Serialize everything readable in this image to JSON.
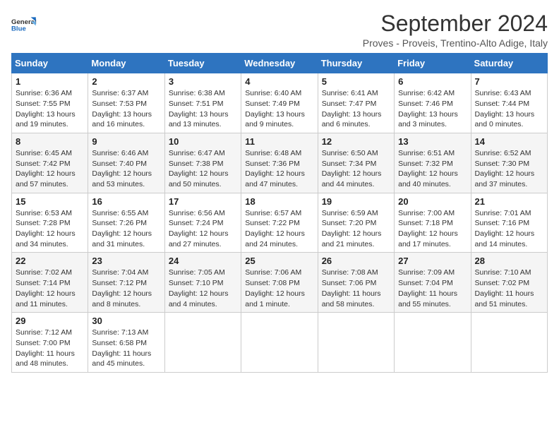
{
  "header": {
    "logo_general": "General",
    "logo_blue": "Blue",
    "month_title": "September 2024",
    "subtitle": "Proves - Proveis, Trentino-Alto Adige, Italy"
  },
  "days_of_week": [
    "Sunday",
    "Monday",
    "Tuesday",
    "Wednesday",
    "Thursday",
    "Friday",
    "Saturday"
  ],
  "weeks": [
    [
      {
        "day": "1",
        "info": "Sunrise: 6:36 AM\nSunset: 7:55 PM\nDaylight: 13 hours\nand 19 minutes."
      },
      {
        "day": "2",
        "info": "Sunrise: 6:37 AM\nSunset: 7:53 PM\nDaylight: 13 hours\nand 16 minutes."
      },
      {
        "day": "3",
        "info": "Sunrise: 6:38 AM\nSunset: 7:51 PM\nDaylight: 13 hours\nand 13 minutes."
      },
      {
        "day": "4",
        "info": "Sunrise: 6:40 AM\nSunset: 7:49 PM\nDaylight: 13 hours\nand 9 minutes."
      },
      {
        "day": "5",
        "info": "Sunrise: 6:41 AM\nSunset: 7:47 PM\nDaylight: 13 hours\nand 6 minutes."
      },
      {
        "day": "6",
        "info": "Sunrise: 6:42 AM\nSunset: 7:46 PM\nDaylight: 13 hours\nand 3 minutes."
      },
      {
        "day": "7",
        "info": "Sunrise: 6:43 AM\nSunset: 7:44 PM\nDaylight: 13 hours\nand 0 minutes."
      }
    ],
    [
      {
        "day": "8",
        "info": "Sunrise: 6:45 AM\nSunset: 7:42 PM\nDaylight: 12 hours\nand 57 minutes."
      },
      {
        "day": "9",
        "info": "Sunrise: 6:46 AM\nSunset: 7:40 PM\nDaylight: 12 hours\nand 53 minutes."
      },
      {
        "day": "10",
        "info": "Sunrise: 6:47 AM\nSunset: 7:38 PM\nDaylight: 12 hours\nand 50 minutes."
      },
      {
        "day": "11",
        "info": "Sunrise: 6:48 AM\nSunset: 7:36 PM\nDaylight: 12 hours\nand 47 minutes."
      },
      {
        "day": "12",
        "info": "Sunrise: 6:50 AM\nSunset: 7:34 PM\nDaylight: 12 hours\nand 44 minutes."
      },
      {
        "day": "13",
        "info": "Sunrise: 6:51 AM\nSunset: 7:32 PM\nDaylight: 12 hours\nand 40 minutes."
      },
      {
        "day": "14",
        "info": "Sunrise: 6:52 AM\nSunset: 7:30 PM\nDaylight: 12 hours\nand 37 minutes."
      }
    ],
    [
      {
        "day": "15",
        "info": "Sunrise: 6:53 AM\nSunset: 7:28 PM\nDaylight: 12 hours\nand 34 minutes."
      },
      {
        "day": "16",
        "info": "Sunrise: 6:55 AM\nSunset: 7:26 PM\nDaylight: 12 hours\nand 31 minutes."
      },
      {
        "day": "17",
        "info": "Sunrise: 6:56 AM\nSunset: 7:24 PM\nDaylight: 12 hours\nand 27 minutes."
      },
      {
        "day": "18",
        "info": "Sunrise: 6:57 AM\nSunset: 7:22 PM\nDaylight: 12 hours\nand 24 minutes."
      },
      {
        "day": "19",
        "info": "Sunrise: 6:59 AM\nSunset: 7:20 PM\nDaylight: 12 hours\nand 21 minutes."
      },
      {
        "day": "20",
        "info": "Sunrise: 7:00 AM\nSunset: 7:18 PM\nDaylight: 12 hours\nand 17 minutes."
      },
      {
        "day": "21",
        "info": "Sunrise: 7:01 AM\nSunset: 7:16 PM\nDaylight: 12 hours\nand 14 minutes."
      }
    ],
    [
      {
        "day": "22",
        "info": "Sunrise: 7:02 AM\nSunset: 7:14 PM\nDaylight: 12 hours\nand 11 minutes."
      },
      {
        "day": "23",
        "info": "Sunrise: 7:04 AM\nSunset: 7:12 PM\nDaylight: 12 hours\nand 8 minutes."
      },
      {
        "day": "24",
        "info": "Sunrise: 7:05 AM\nSunset: 7:10 PM\nDaylight: 12 hours\nand 4 minutes."
      },
      {
        "day": "25",
        "info": "Sunrise: 7:06 AM\nSunset: 7:08 PM\nDaylight: 12 hours\nand 1 minute."
      },
      {
        "day": "26",
        "info": "Sunrise: 7:08 AM\nSunset: 7:06 PM\nDaylight: 11 hours\nand 58 minutes."
      },
      {
        "day": "27",
        "info": "Sunrise: 7:09 AM\nSunset: 7:04 PM\nDaylight: 11 hours\nand 55 minutes."
      },
      {
        "day": "28",
        "info": "Sunrise: 7:10 AM\nSunset: 7:02 PM\nDaylight: 11 hours\nand 51 minutes."
      }
    ],
    [
      {
        "day": "29",
        "info": "Sunrise: 7:12 AM\nSunset: 7:00 PM\nDaylight: 11 hours\nand 48 minutes."
      },
      {
        "day": "30",
        "info": "Sunrise: 7:13 AM\nSunset: 6:58 PM\nDaylight: 11 hours\nand 45 minutes."
      },
      {
        "day": "",
        "info": ""
      },
      {
        "day": "",
        "info": ""
      },
      {
        "day": "",
        "info": ""
      },
      {
        "day": "",
        "info": ""
      },
      {
        "day": "",
        "info": ""
      }
    ]
  ]
}
